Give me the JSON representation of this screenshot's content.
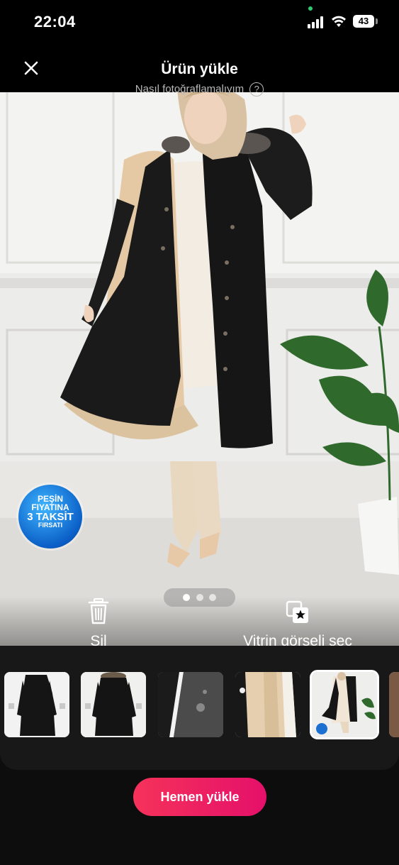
{
  "status_bar": {
    "time": "22:04",
    "battery": "43"
  },
  "header": {
    "title": "Ürün yükle",
    "help_text": "Nasıl fotoğraflamalıyım",
    "help_icon_glyph": "?"
  },
  "promo_badge": {
    "line1": "PEŞİN",
    "line2": "FIYATINA",
    "line3": "3 TAKSİT",
    "line4": "FIRSATI"
  },
  "pager": {
    "count": 3,
    "active": 1
  },
  "actions": {
    "delete_label": "Sil",
    "showcase_label": "Vitrin görseli seç"
  },
  "thumbnails": [
    {
      "name": "black-coat-front",
      "selected": false
    },
    {
      "name": "black-coat-model",
      "selected": false
    },
    {
      "name": "coat-zipper-detail",
      "selected": false
    },
    {
      "name": "fur-lining-detail",
      "selected": false
    },
    {
      "name": "model-full-view",
      "selected": true
    },
    {
      "name": "partial-thumbnail",
      "selected": false
    }
  ],
  "upload_button": {
    "label": "Hemen yükle"
  },
  "colors": {
    "accent_start": "#f5325a",
    "accent_end": "#e5106a",
    "badge_blue": "#0b5fc7"
  }
}
